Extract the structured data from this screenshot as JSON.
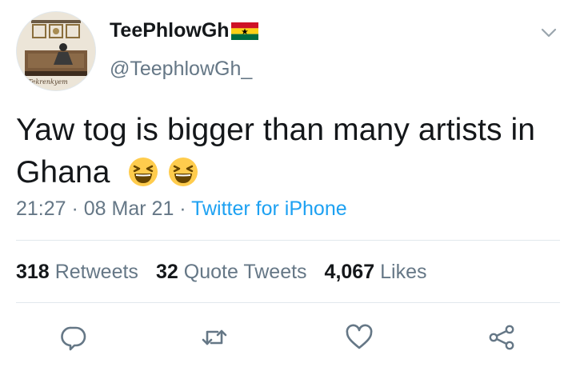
{
  "author": {
    "display_name": "TeePhlowGh",
    "handle": "@TeephlowGh_",
    "avatar_alt": "profile-photo",
    "flag": "ghana-flag-icon"
  },
  "tweet": {
    "text": "Yaw tog is bigger than many artists in Ghana",
    "emojis": [
      "laughing-face-emoji",
      "laughing-face-emoji"
    ]
  },
  "meta": {
    "time": "21:27",
    "sep1": " · ",
    "date": "08 Mar 21",
    "sep2": " · ",
    "source": "Twitter for iPhone"
  },
  "stats": {
    "retweets_count": "318",
    "retweets_label": "Retweets",
    "quotes_count": "32",
    "quotes_label": "Quote Tweets",
    "likes_count": "4,067",
    "likes_label": "Likes"
  },
  "actions": [
    "reply-icon",
    "retweet-icon",
    "like-icon",
    "share-icon"
  ],
  "colors": {
    "accent": "#1da1f2",
    "secondary_text": "#657786",
    "icon": "#657786",
    "divider": "#e1e8ed"
  }
}
